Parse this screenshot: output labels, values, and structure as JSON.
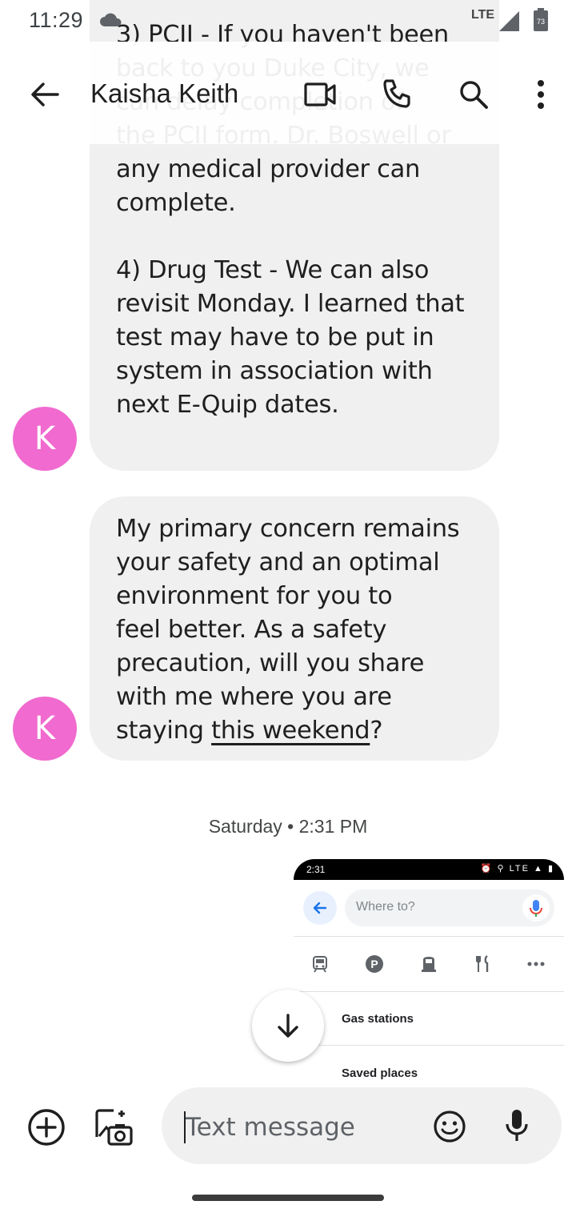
{
  "status_bar": {
    "time": "11:29",
    "network": "LTE",
    "battery_level": "73"
  },
  "header": {
    "contact_name": "Kaisha Keith"
  },
  "messages": [
    {
      "sender_initial": "K",
      "text": "3) PCII - If you haven't been\nback to you Duke City, we\ncan delay completion of\nthe PCII form. Dr. Boswell or\nany medical provider can\ncomplete.\n\n4) Drug Test - We can also\nrevisit Monday. I learned that\ntest may have to be put in\nsystem in association with\nnext E-Quip dates."
    },
    {
      "sender_initial": "K",
      "text_before_link": "My primary concern remains\nyour safety and an optimal\nenvironment for you to\nfeel better. As a safety\nprecaution, will you share\nwith me where you are\nstaying ",
      "link_text": "this weekend",
      "text_after_link": "?"
    }
  ],
  "timestamp": "Saturday • 2:31 PM",
  "attachment": {
    "status_time": "2:31",
    "status_icons": "⏰ ⚲ LTE ▲ ▮",
    "search_placeholder": "Where to?",
    "category_icons": [
      "train-icon",
      "parking-icon",
      "gas-station-icon",
      "restaurant-icon",
      "more-icon"
    ],
    "rows": [
      {
        "label": "Gas stations"
      },
      {
        "label": "Saved places"
      }
    ]
  },
  "composer": {
    "placeholder": "Text message"
  },
  "colors": {
    "avatar": "#f06acf",
    "bubble": "#f0f0f0",
    "accent_blue": "#1a73e8"
  }
}
